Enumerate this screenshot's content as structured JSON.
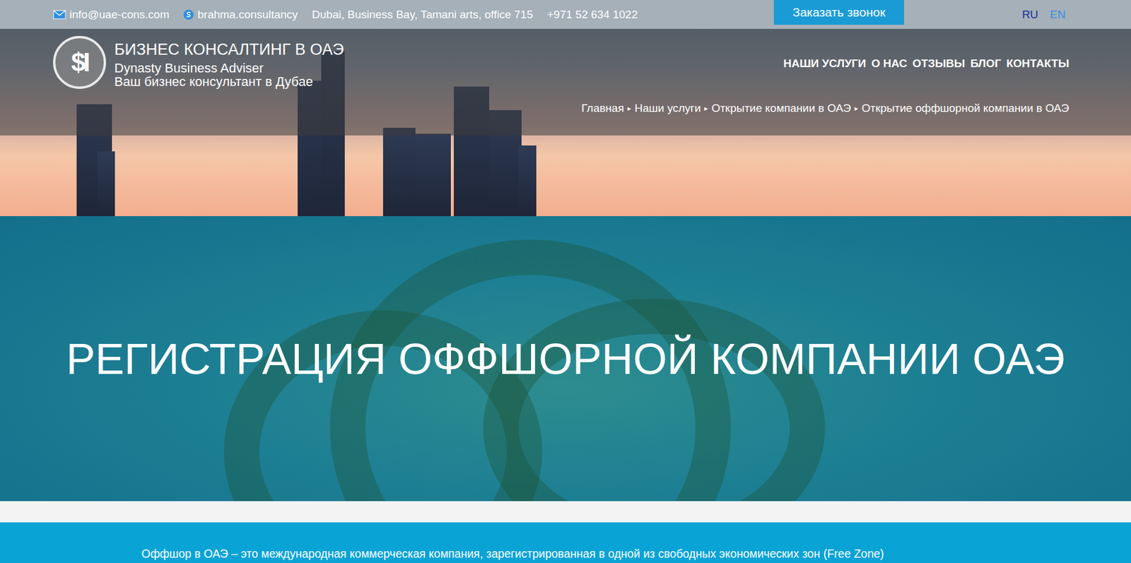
{
  "topbar": {
    "email": "info@uae-cons.com",
    "skype": "brahma.consultancy",
    "address": "Dubai, Business Bay, Tamani arts, office 715",
    "phone": "+971 52 634 1022",
    "callback_button": "Заказать звонок",
    "languages": [
      {
        "label": "RU",
        "selected": true
      },
      {
        "label": "EN",
        "selected": false
      }
    ]
  },
  "brand": {
    "logo": "$I",
    "title": "БИЗНЕС КОНСАЛТИНГ В ОАЭ",
    "name": "Dynasty Business Adviser",
    "tagline": "Ваш бизнес консультант в Дубае"
  },
  "nav": [
    "НАШИ УСЛУГИ",
    "О НАС",
    "ОТЗЫВЫ",
    "БЛОГ",
    "КОНТАКТЫ"
  ],
  "breadcrumb": {
    "separator": "▸",
    "items": [
      "Главная",
      "Наши услуги",
      "Открытие компании в ОАЭ",
      "Открытие оффшорной компании в ОАЭ"
    ]
  },
  "hero": {
    "title": "РЕГИСТРАЦИЯ ОФФШОРНОЙ КОМПАНИИ ОАЭ"
  },
  "intro": {
    "text": "Оффшор в ОАЭ – это международная коммерческая компания, зарегистрированная в одной из свободных экономических зон (Free Zone)"
  }
}
